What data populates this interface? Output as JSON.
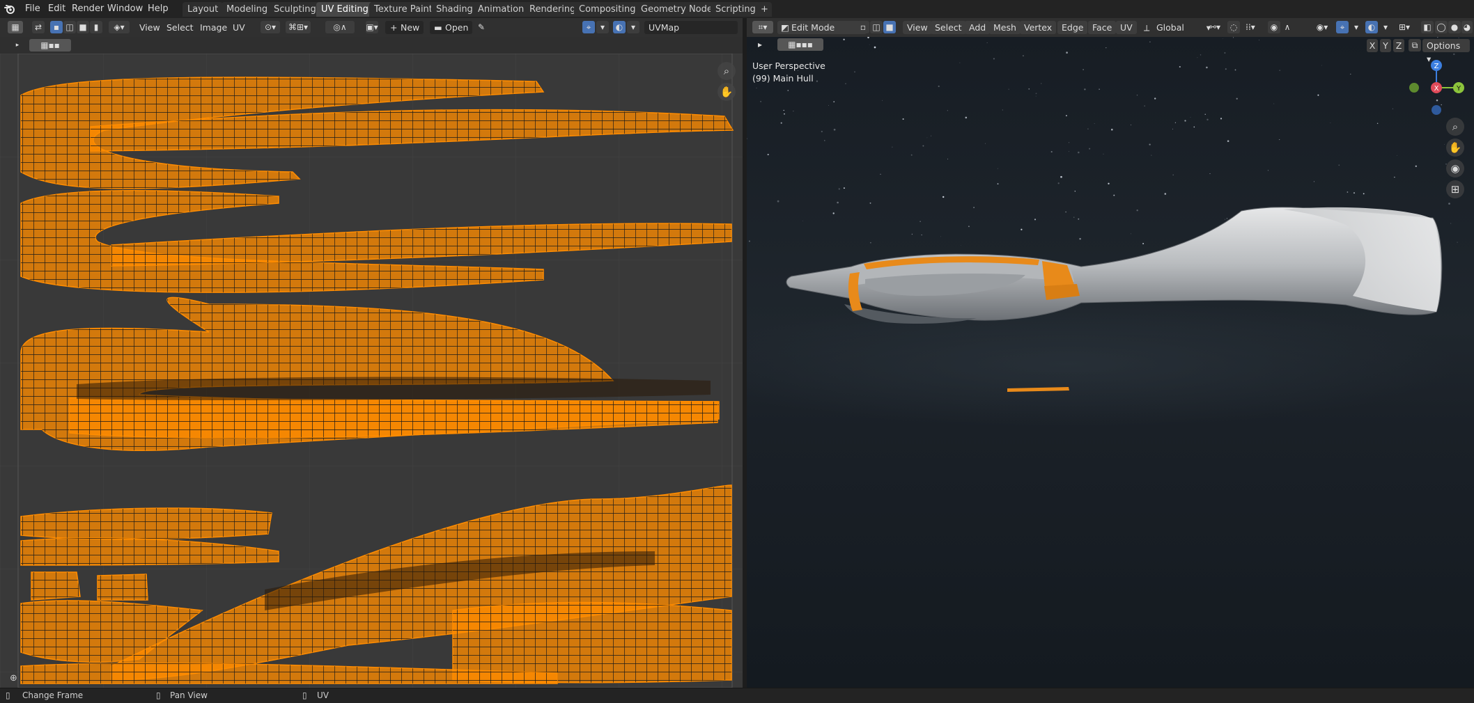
{
  "topbar": {
    "menus": [
      "File",
      "Edit",
      "Render",
      "Window",
      "Help"
    ],
    "workspaces": [
      {
        "label": "Layout",
        "active": false
      },
      {
        "label": "Modeling",
        "active": false
      },
      {
        "label": "Sculpting",
        "active": false
      },
      {
        "label": "UV Editing",
        "active": true
      },
      {
        "label": "Texture Paint",
        "active": false
      },
      {
        "label": "Shading",
        "active": false
      },
      {
        "label": "Animation",
        "active": false
      },
      {
        "label": "Rendering",
        "active": false
      },
      {
        "label": "Compositing",
        "active": false
      },
      {
        "label": "Geometry Nodes",
        "active": false
      },
      {
        "label": "Scripting",
        "active": false
      }
    ],
    "add_workspace_symbol": "+"
  },
  "uv_editor": {
    "menus": [
      "View",
      "Select",
      "Image",
      "UV"
    ],
    "new_label": "New",
    "open_label": "Open",
    "uv_map_name": "UVMap",
    "uv_color": "#ff8c00"
  },
  "viewport": {
    "mode_label": "Edit Mode",
    "menus": [
      "View",
      "Select",
      "Add",
      "Mesh",
      "Vertex",
      "Edge",
      "Face",
      "UV"
    ],
    "transform_orientation": "Global",
    "axis_toggles": [
      "X",
      "Y",
      "Z"
    ],
    "options_label": "Options",
    "perspective_label": "User Perspective",
    "object_label": "(99) Main Hull",
    "gizmo_axes": {
      "z": "Z",
      "x": "X",
      "y": "Y"
    },
    "axis_colors": {
      "x": "#e04b5a",
      "y": "#8cc43c",
      "z": "#3c7fe0"
    }
  },
  "statusbar": {
    "items": [
      "Change Frame",
      "Pan View",
      "UV"
    ]
  }
}
